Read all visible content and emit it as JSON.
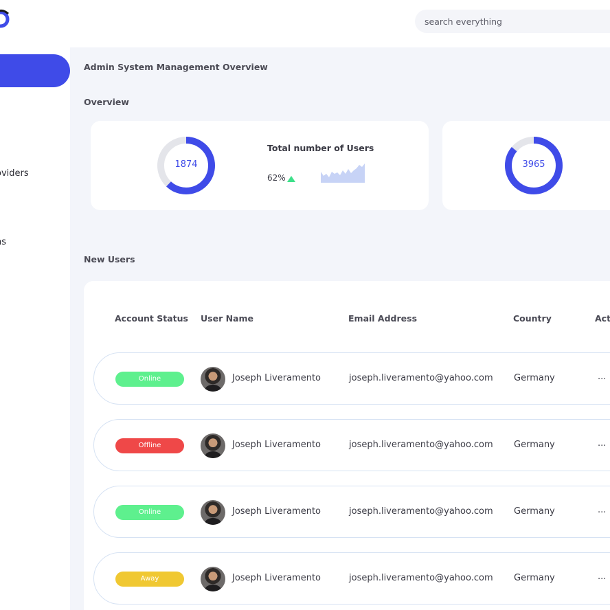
{
  "header": {
    "search": {
      "placeholder": "search everything",
      "value": ""
    }
  },
  "sidebar": {
    "items": [
      {
        "label": "",
        "active": true
      },
      {
        "label": "oviders",
        "active": false
      },
      {
        "label": "ns",
        "active": false
      }
    ]
  },
  "main": {
    "page_title": "Admin System Management Overview",
    "overview": {
      "title": "Overview",
      "cards": [
        {
          "donut_value": "1874",
          "donut_fraction": 0.62,
          "stat_title": "Total number of Users",
          "stat_percent": "62%",
          "trend": "up"
        },
        {
          "donut_value": "3965",
          "donut_fraction": 0.86
        }
      ]
    },
    "new_users": {
      "title": "New Users",
      "columns": [
        "Account Status",
        "User Name",
        "Email Address",
        "Country",
        "Act"
      ],
      "rows": [
        {
          "status": "Online",
          "status_color": "#5ef08e",
          "name": "Joseph Liveramento",
          "email": "joseph.liveramento@yahoo.com",
          "country": "Germany",
          "actions": "..."
        },
        {
          "status": "Offline",
          "status_color": "#ef4848",
          "name": "Joseph Liveramento",
          "email": "joseph.liveramento@yahoo.com",
          "country": "Germany",
          "actions": "..."
        },
        {
          "status": "Online",
          "status_color": "#5ef08e",
          "name": "Joseph Liveramento",
          "email": "joseph.liveramento@yahoo.com",
          "country": "Germany",
          "actions": "..."
        },
        {
          "status": "Away",
          "status_color": "#f0c832",
          "name": "Joseph Liveramento",
          "email": "joseph.liveramento@yahoo.com",
          "country": "Germany",
          "actions": "..."
        }
      ]
    }
  },
  "colors": {
    "accent": "#3f4be8",
    "donut_track": "#e4e5ea",
    "sparkline": "#c7d3f6",
    "trend_up": "#3ee08a",
    "page_bg": "#f3f5fa"
  }
}
